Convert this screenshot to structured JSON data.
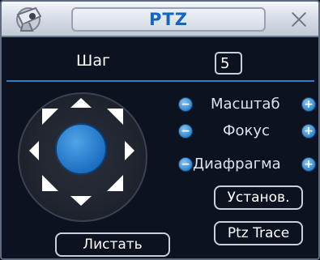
{
  "window": {
    "title": "PTZ"
  },
  "step": {
    "label": "Шаг",
    "value": "5"
  },
  "controls": [
    {
      "label": "Масштаб",
      "minus": "−",
      "plus": "+"
    },
    {
      "label": "Фокус",
      "minus": "−",
      "plus": "+"
    },
    {
      "label": "Диафрагма",
      "minus": "−",
      "plus": "+"
    }
  ],
  "buttons": {
    "setup": "Установ.",
    "trace": "Ptz Trace",
    "page": "Листать"
  },
  "colors": {
    "accent": "#2f80c9",
    "title": "#1565c0",
    "background": "#0c1220"
  }
}
